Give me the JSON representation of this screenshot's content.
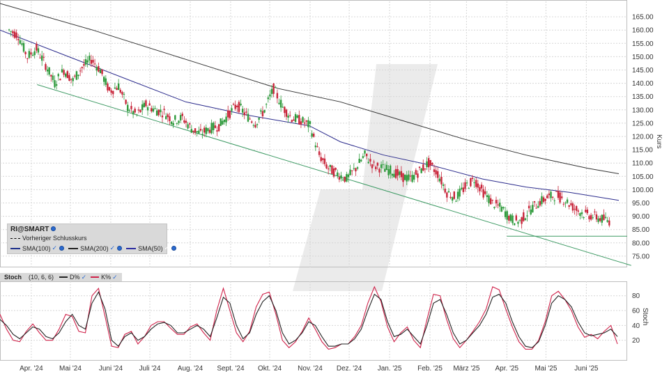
{
  "chart_data": [
    {
      "type": "candlestick",
      "title": "",
      "ylabel": "Kurs",
      "ylim": [
        70,
        170
      ],
      "y_ticks": [
        "165.00",
        "160.00",
        "155.00",
        "150.00",
        "145.00",
        "140.00",
        "135.00",
        "130.00",
        "125.00",
        "120.00",
        "115.00",
        "110.00",
        "105.00",
        "100.00",
        "95.00",
        "90.00",
        "85.00",
        "80.00",
        "75.00"
      ],
      "x_ticks": [
        "Apr. '24",
        "Mai '24",
        "Juni '24",
        "Juli '24",
        "Aug. '24",
        "Sept. '24",
        "Okt. '24",
        "Nov. '24",
        "Dez. '24",
        "Jan. '25",
        "Feb. '25",
        "März '25",
        "Apr. '25",
        "Mai '25",
        "Juni '25"
      ],
      "grid": true,
      "legend": {
        "title": "RI@SMART",
        "items": [
          "Vorheriger Schlusskurs",
          "SMA(100)",
          "SMA(200)",
          "SMA(50)"
        ],
        "colors": [
          "#000000",
          "#1b2e8a",
          "#222222",
          "#2c2ca0"
        ],
        "placement": "bottom-left"
      },
      "close_series": [
        [
          "2024-03-15",
          160
        ],
        [
          "2024-03-22",
          158
        ],
        [
          "2024-03-29",
          150
        ],
        [
          "2024-04-05",
          153
        ],
        [
          "2024-04-12",
          147
        ],
        [
          "2024-04-19",
          140
        ],
        [
          "2024-04-26",
          145
        ],
        [
          "2024-05-03",
          141
        ],
        [
          "2024-05-10",
          146
        ],
        [
          "2024-05-17",
          149
        ],
        [
          "2024-05-24",
          145
        ],
        [
          "2024-05-31",
          137
        ],
        [
          "2024-06-07",
          139
        ],
        [
          "2024-06-14",
          131
        ],
        [
          "2024-06-21",
          128
        ],
        [
          "2024-06-28",
          132
        ],
        [
          "2024-07-05",
          130
        ],
        [
          "2024-07-12",
          129
        ],
        [
          "2024-07-19",
          126
        ],
        [
          "2024-07-26",
          127
        ],
        [
          "2024-08-02",
          123
        ],
        [
          "2024-08-09",
          121
        ],
        [
          "2024-08-16",
          123
        ],
        [
          "2024-08-23",
          124
        ],
        [
          "2024-08-30",
          128
        ],
        [
          "2024-09-06",
          132
        ],
        [
          "2024-09-13",
          128
        ],
        [
          "2024-09-20",
          125
        ],
        [
          "2024-09-27",
          130
        ],
        [
          "2024-10-04",
          138
        ],
        [
          "2024-10-11",
          131
        ],
        [
          "2024-10-18",
          127
        ],
        [
          "2024-10-25",
          126
        ],
        [
          "2024-11-01",
          124
        ],
        [
          "2024-11-08",
          113
        ],
        [
          "2024-11-15",
          108
        ],
        [
          "2024-11-22",
          106
        ],
        [
          "2024-11-29",
          104
        ],
        [
          "2024-12-06",
          108
        ],
        [
          "2024-12-13",
          113
        ],
        [
          "2024-12-20",
          109
        ],
        [
          "2024-12-27",
          108
        ],
        [
          "2025-01-03",
          107
        ],
        [
          "2025-01-10",
          105
        ],
        [
          "2025-01-17",
          104
        ],
        [
          "2025-01-24",
          107
        ],
        [
          "2025-01-31",
          110
        ],
        [
          "2025-02-07",
          106
        ],
        [
          "2025-02-14",
          99
        ],
        [
          "2025-02-21",
          97
        ],
        [
          "2025-02-28",
          101
        ],
        [
          "2025-03-07",
          104
        ],
        [
          "2025-03-14",
          99
        ],
        [
          "2025-03-21",
          95
        ],
        [
          "2025-03-28",
          93
        ],
        [
          "2025-04-04",
          89
        ],
        [
          "2025-04-11",
          88
        ],
        [
          "2025-04-18",
          92
        ],
        [
          "2025-04-25",
          95
        ],
        [
          "2025-05-02",
          97
        ],
        [
          "2025-05-09",
          98
        ],
        [
          "2025-05-16",
          96
        ],
        [
          "2025-05-23",
          93
        ],
        [
          "2025-05-30",
          91
        ],
        [
          "2025-06-06",
          90
        ],
        [
          "2025-06-13",
          89
        ],
        [
          "2025-06-20",
          88
        ]
      ],
      "sma200": [
        [
          0,
          170
        ],
        [
          0.15,
          160
        ],
        [
          0.3,
          149
        ],
        [
          0.45,
          138
        ],
        [
          0.55,
          133
        ],
        [
          0.65,
          126
        ],
        [
          0.75,
          119
        ],
        [
          0.85,
          113
        ],
        [
          0.95,
          108
        ],
        [
          1.0,
          106
        ]
      ],
      "sma100": [
        [
          0,
          160
        ],
        [
          0.1,
          151
        ],
        [
          0.2,
          142
        ],
        [
          0.3,
          133
        ],
        [
          0.4,
          128
        ],
        [
          0.5,
          124
        ],
        [
          0.55,
          118
        ],
        [
          0.62,
          113
        ],
        [
          0.7,
          109
        ],
        [
          0.78,
          104
        ],
        [
          0.85,
          101
        ],
        [
          0.92,
          99
        ],
        [
          1.0,
          96
        ]
      ],
      "trendline": [
        [
          0.06,
          139.5
        ],
        [
          1.02,
          71.5
        ]
      ],
      "support_level": 82.5
    },
    {
      "type": "line",
      "title": "Stoch",
      "params": "(10, 6, 6)",
      "ylabel": "Stoch",
      "ylim": [
        0,
        100
      ],
      "y_ticks": [
        "80",
        "60",
        "40",
        "20"
      ],
      "series": [
        {
          "name": "D%",
          "color": "#222222",
          "values": [
            48,
            40,
            28,
            22,
            30,
            38,
            35,
            25,
            22,
            30,
            45,
            55,
            40,
            35,
            70,
            85,
            62,
            20,
            12,
            25,
            30,
            20,
            25,
            35,
            42,
            44,
            40,
            30,
            30,
            35,
            40,
            35,
            25,
            50,
            78,
            70,
            40,
            22,
            30,
            55,
            72,
            80,
            60,
            30,
            15,
            20,
            30,
            45,
            40,
            25,
            12,
            12,
            15,
            15,
            22,
            35,
            60,
            82,
            75,
            45,
            25,
            28,
            35,
            25,
            15,
            40,
            70,
            75,
            55,
            30,
            15,
            20,
            30,
            40,
            55,
            78,
            82,
            70,
            45,
            25,
            12,
            10,
            18,
            40,
            70,
            80,
            75,
            65,
            45,
            30,
            26,
            28,
            30,
            35,
            25
          ]
        },
        {
          "name": "K%",
          "color": "#d0224a",
          "values": [
            55,
            35,
            20,
            18,
            32,
            42,
            30,
            20,
            20,
            35,
            55,
            52,
            32,
            30,
            80,
            90,
            52,
            12,
            10,
            28,
            32,
            15,
            25,
            40,
            45,
            45,
            36,
            28,
            28,
            38,
            42,
            30,
            20,
            60,
            90,
            60,
            30,
            18,
            32,
            65,
            82,
            85,
            55,
            20,
            10,
            18,
            32,
            50,
            35,
            18,
            8,
            10,
            15,
            15,
            25,
            40,
            70,
            92,
            72,
            38,
            18,
            30,
            38,
            20,
            10,
            48,
            82,
            80,
            48,
            22,
            10,
            20,
            32,
            45,
            62,
            92,
            88,
            62,
            38,
            18,
            8,
            8,
            20,
            45,
            80,
            86,
            75,
            60,
            38,
            24,
            28,
            22,
            32,
            40,
            15
          ]
        }
      ]
    }
  ],
  "legend_box": {
    "title": "RI@SMART",
    "prev_close_label": "Vorheriger Schlusskurs",
    "sma100_label": "SMA(100)",
    "sma200_label": "SMA(200)",
    "sma50_label": "SMA(50)"
  },
  "stoch_bar": {
    "title": "Stoch",
    "params": "(10, 6, 6)",
    "d_label": "D%",
    "k_label": "K%"
  },
  "colors": {
    "up": "#2e9a3c",
    "down": "#c8253a",
    "sma200": "#333333",
    "sma100": "#2b2b8c",
    "trend": "#3e9a64",
    "grid": "#d6d6d6"
  }
}
